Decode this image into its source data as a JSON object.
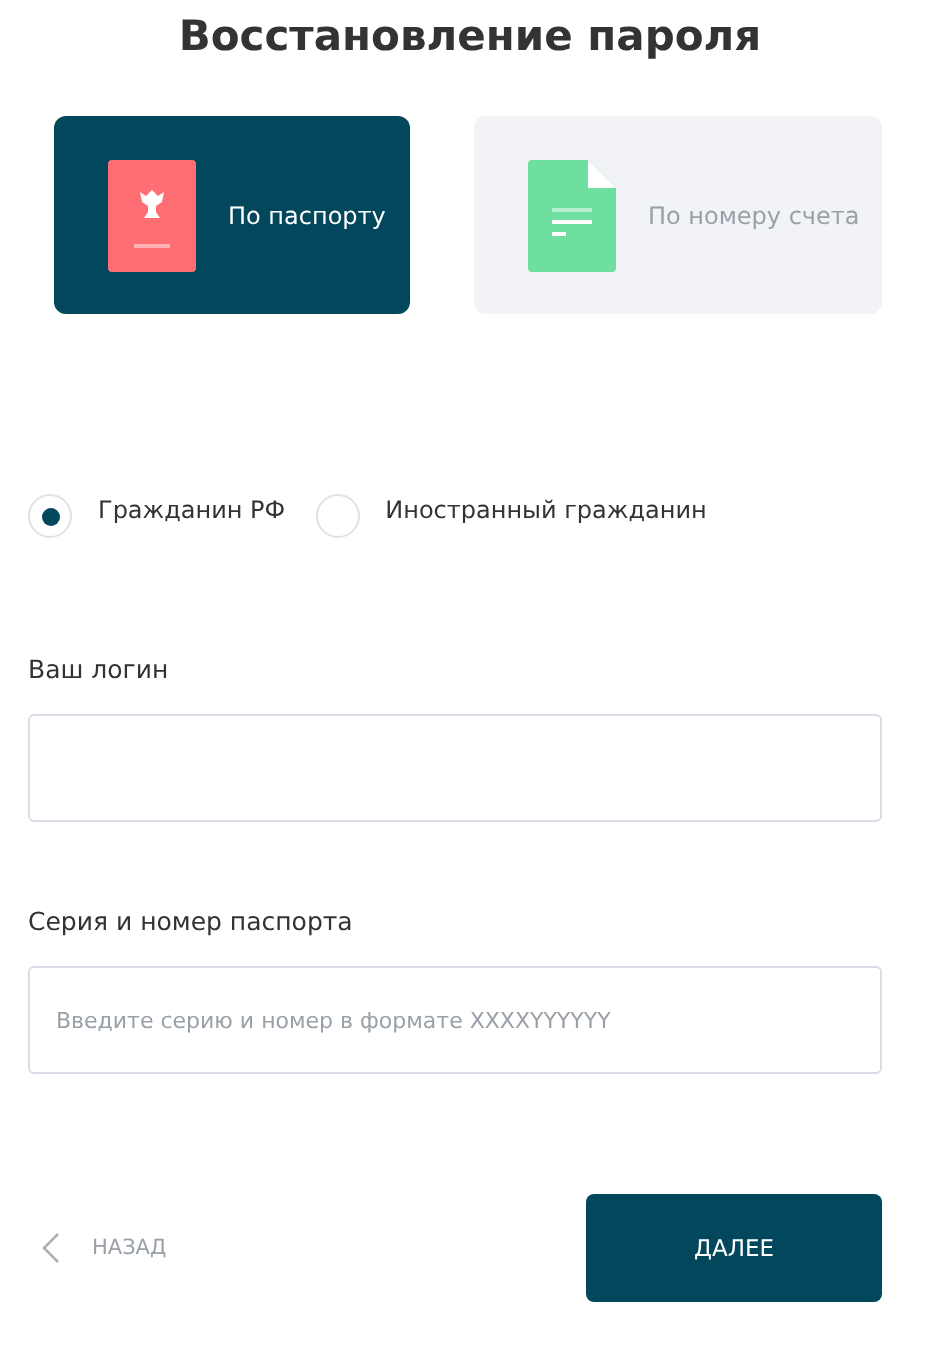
{
  "title": "Восстановление пароля",
  "methods": [
    {
      "label": "По паспорту",
      "kind": "passport",
      "selected": true
    },
    {
      "label": "По номеру счета",
      "kind": "document",
      "selected": false
    }
  ],
  "citizenship": [
    {
      "label": "Гражданин РФ",
      "selected": true
    },
    {
      "label": "Иностранный гражданин",
      "selected": false
    }
  ],
  "fields": [
    {
      "label": "Ваш логин"
    },
    {
      "label": "Серия и номер паспорта",
      "placeholder": "Введите серию и номер в формате XXXXYYYYYY"
    }
  ],
  "back_button": "НАЗАД",
  "next_button": "ДАЛЕЕ"
}
